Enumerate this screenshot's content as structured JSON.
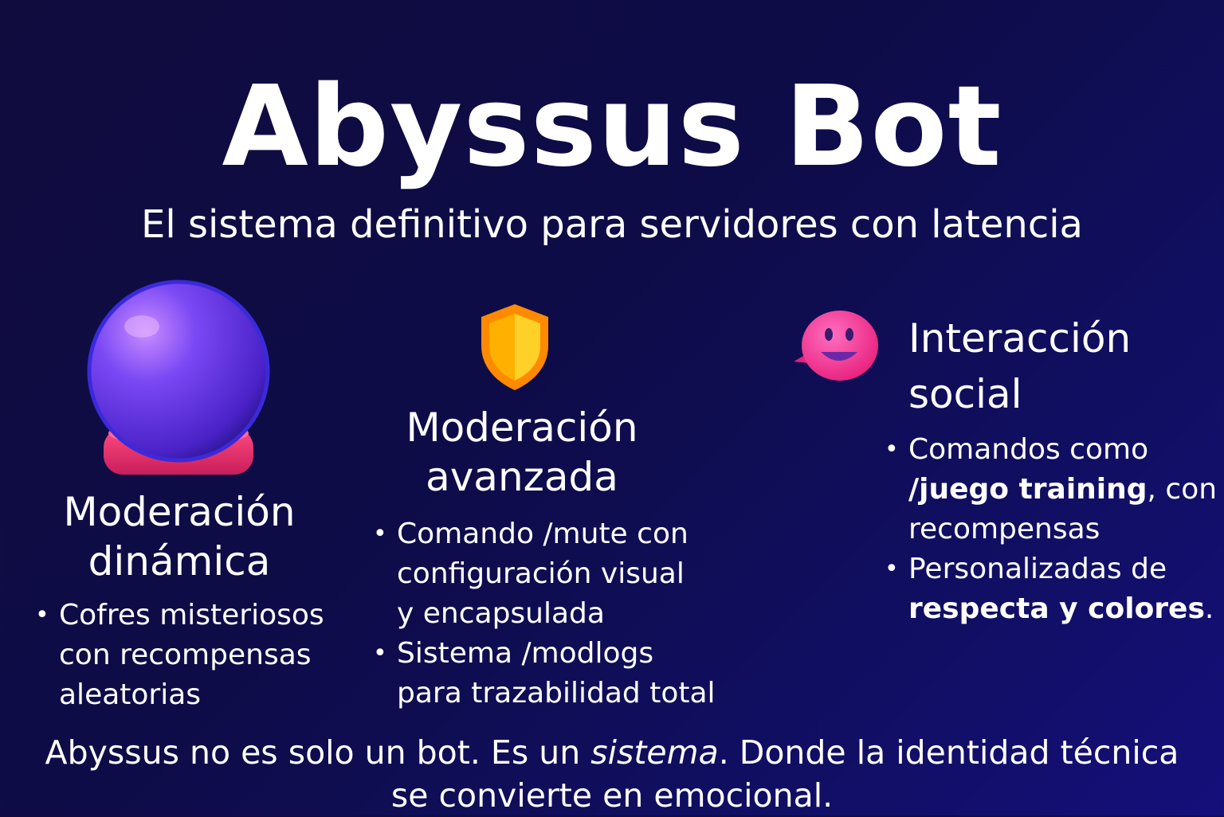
{
  "header": {
    "title": "Abyssus Bot",
    "subtitle": "El sistema definitivo para servidores con latencia"
  },
  "features": [
    {
      "icon": "crystal-ball-icon",
      "heading_line1": "Moderación",
      "heading_line2": "dinámica",
      "bullets": [
        {
          "lines": [
            "Cofres misteriosos",
            "con recompensas",
            "aleatorias"
          ]
        }
      ]
    },
    {
      "icon": "shield-icon",
      "heading_line1": "Moderación",
      "heading_line2": "avanzada",
      "bullets": [
        {
          "lines": [
            "Comando /mute con",
            "configuración visual",
            "y encapsulada"
          ]
        },
        {
          "lines": [
            "Sistema /modlogs",
            "para trazabilidad total"
          ]
        }
      ]
    },
    {
      "icon": "smiley-speech-bubble-icon",
      "heading_line1": "Interacción",
      "heading_line2": "social",
      "bullets": [
        {
          "line1": "Comandos como",
          "line2_bold": "/juego training",
          "line2_rest": ", con",
          "line3": "recompensas"
        },
        {
          "line1": "Personalizadas de",
          "line2_bold": "respecta y colores",
          "line2_rest": "."
        }
      ]
    }
  ],
  "footer": {
    "part1": "Abyssus no es solo un bot. Es un ",
    "emphasis": "sistema",
    "part2": ". Donde la identidad técnica",
    "line2": "se convierte en emocional."
  },
  "colors": {
    "background": "#0e0c48",
    "orb": "#6a3cf0",
    "orb_base": "#e8306a",
    "shield": "#ffb000",
    "smiley": "#ff3a9a",
    "text": "#ffffff"
  }
}
